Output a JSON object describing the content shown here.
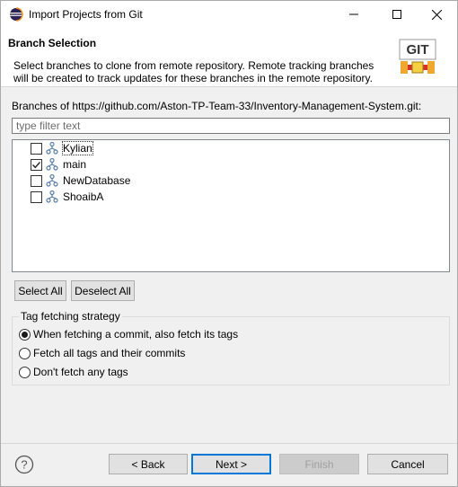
{
  "window": {
    "title": "Import Projects from Git",
    "icons": {
      "app": "eclipse-icon",
      "minimize": "minimize-icon",
      "maximize": "maximize-icon",
      "close": "close-icon"
    }
  },
  "header": {
    "title": "Branch Selection",
    "description_line1": "Select branches to clone from remote repository. Remote tracking branches",
    "description_line2": "will be created to track updates for these branches in the remote repository.",
    "logo_text": "GIT"
  },
  "branches": {
    "label": "Branches of https://github.com/Aston-TP-Team-33/Inventory-Management-System.git:",
    "filter_placeholder": "type filter text",
    "filter_value": "",
    "items": [
      {
        "name": "Kylian",
        "checked": false
      },
      {
        "name": "main",
        "checked": true
      },
      {
        "name": "NewDatabase",
        "checked": false
      },
      {
        "name": "ShoaibA",
        "checked": false
      }
    ],
    "select_all_label": "Select All",
    "deselect_all_label": "Deselect All"
  },
  "tag_strategy": {
    "legend": "Tag fetching strategy",
    "options": [
      {
        "label": "When fetching a commit, also fetch its tags",
        "selected": true
      },
      {
        "label": "Fetch all tags and their commits",
        "selected": false
      },
      {
        "label": "Don't fetch any tags",
        "selected": false
      }
    ]
  },
  "footer": {
    "back_label": "< Back",
    "next_label": "Next >",
    "finish_label": "Finish",
    "cancel_label": "Cancel",
    "help_icon": "help-icon"
  },
  "colors": {
    "accent": "#0078d7",
    "branch_icon": "#5a7fa8",
    "git_logo_red": "#d6322a",
    "git_logo_orange": "#f0a830"
  }
}
